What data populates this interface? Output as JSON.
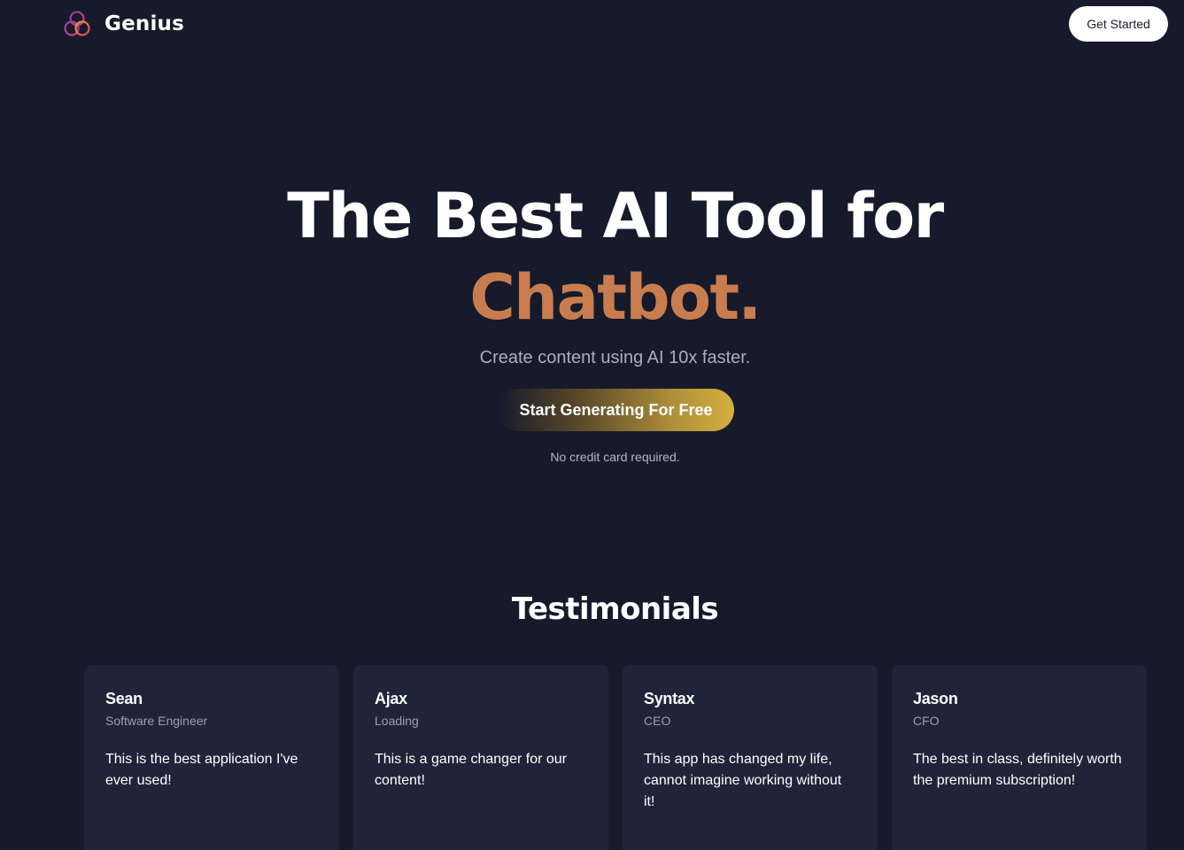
{
  "nav": {
    "brand": "Genius",
    "get_started_label": "Get Started"
  },
  "hero": {
    "title_line1": "The Best AI Tool for",
    "title_accent": "Chatbot.",
    "subtitle": "Create content using AI 10x faster.",
    "cta_label": "Start Generating For Free",
    "note": "No credit card required."
  },
  "testimonials": {
    "heading": "Testimonials",
    "items": [
      {
        "name": "Sean",
        "role": "Software Engineer",
        "quote": "This is the best application I've ever used!"
      },
      {
        "name": "Ajax",
        "role": "Loading",
        "quote": "This is a game changer for our content!"
      },
      {
        "name": "Syntax",
        "role": "CEO",
        "quote": "This app has changed my life, cannot imagine working without it!"
      },
      {
        "name": "Jason",
        "role": "CFO",
        "quote": "The best in class, definitely worth the premium subscription!"
      }
    ]
  },
  "colors": {
    "background": "#161a2b",
    "card": "#1f2438",
    "accent": "#c97d4f",
    "cta_gold": "#d4b03f"
  },
  "icons": {
    "logo": "genius-trefoil-logo-icon"
  }
}
